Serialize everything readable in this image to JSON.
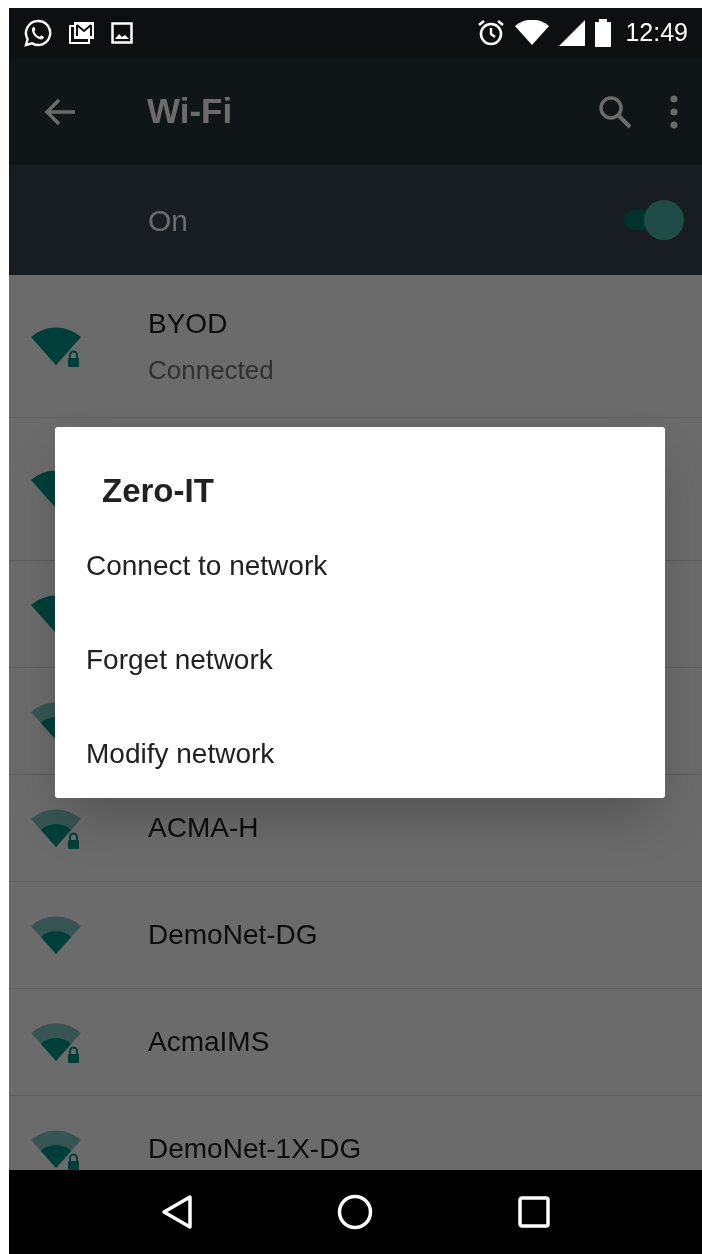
{
  "status_bar": {
    "time": "12:49"
  },
  "app_bar": {
    "title": "Wi-Fi"
  },
  "wifi_switch": {
    "label": "On",
    "on": true
  },
  "networks": [
    {
      "kind": "named",
      "name": "BYOD",
      "status": "Connected",
      "full_signal": true,
      "locked": true
    },
    {
      "kind": "tall",
      "full_signal": true
    },
    {
      "kind": "covered",
      "full_signal": true
    },
    {
      "kind": "covered",
      "full_signal": false
    },
    {
      "kind": "named",
      "name": "ACMA-H",
      "full_signal": false,
      "locked": true
    },
    {
      "kind": "named",
      "name": "DemoNet-DG",
      "full_signal": false,
      "locked": false
    },
    {
      "kind": "named",
      "name": "AcmaIMS",
      "full_signal": false,
      "locked": true
    },
    {
      "kind": "named",
      "name": "DemoNet-1X-DG",
      "full_signal": false,
      "locked": true
    }
  ],
  "dialog": {
    "title": "Zero-IT",
    "options": [
      "Connect to network",
      "Forget network",
      "Modify network"
    ]
  }
}
